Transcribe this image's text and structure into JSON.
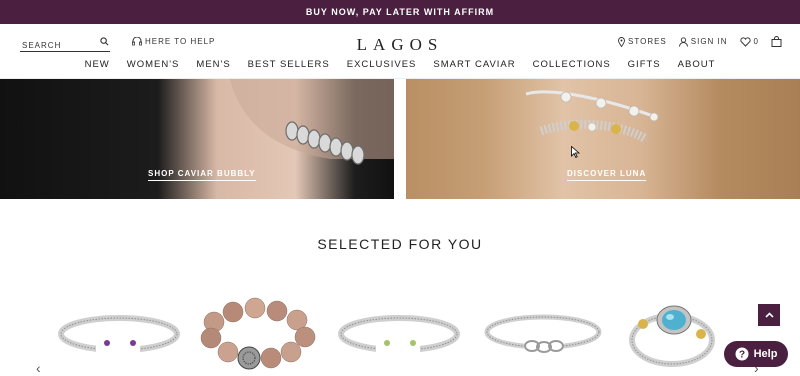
{
  "promo": {
    "text": "BUY NOW, PAY LATER WITH AFFIRM"
  },
  "header": {
    "search_placeholder": "SEARCH",
    "help_label": "HERE TO HELP",
    "logo": "LAGOS",
    "stores_label": "STORES",
    "signin_label": "SIGN IN",
    "wishlist_count": "0"
  },
  "nav": [
    "NEW",
    "WOMEN'S",
    "MEN'S",
    "BEST SELLERS",
    "EXCLUSIVES",
    "SMART CAVIAR",
    "COLLECTIONS",
    "GIFTS",
    "ABOUT"
  ],
  "heroes": {
    "left_link": "SHOP CAVIAR BUBBLY",
    "right_link": "DISCOVER LUNA"
  },
  "section_title": "SELECTED FOR YOU",
  "help_button": "Help",
  "colors": {
    "brand": "#4a1f3f"
  }
}
